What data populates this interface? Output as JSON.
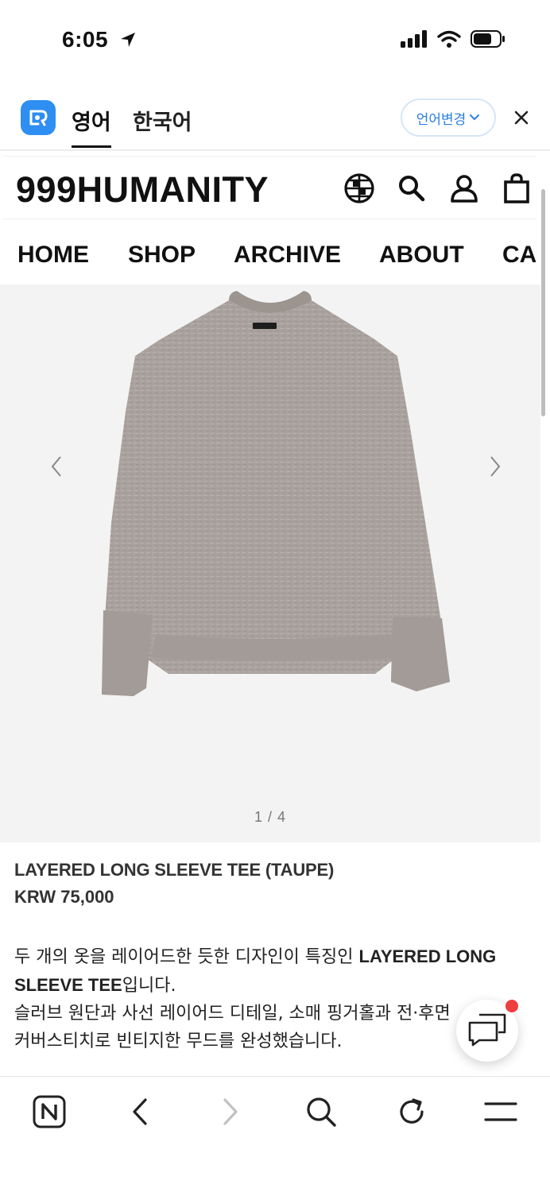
{
  "status_bar": {
    "time": "6:05"
  },
  "translate_bar": {
    "active_lang": "영어",
    "inactive_lang": "한국어",
    "change_label": "언어변경"
  },
  "site": {
    "logo": "999HUMANITY",
    "nav": [
      "HOME",
      "SHOP",
      "ARCHIVE",
      "ABOUT",
      "CA"
    ]
  },
  "gallery": {
    "counter": "1 / 4"
  },
  "product": {
    "title": "LAYERED LONG SLEEVE TEE (TAUPE)",
    "price": "KRW 75,000",
    "desc_line1_prefix": "두 개의 옷을 레이어드한 듯한 디자인이 특징인 ",
    "desc_line1_bold": "LAYERED LONG SLEEVE TEE",
    "desc_line1_suffix": "입니다.",
    "desc_line2": "슬러브 원단과 사선 레이어드 디테일, 소매 핑거홀과 전·후면",
    "desc_line3": "커버스티치로 빈티지한 무드를 완성했습니다."
  },
  "colors": {
    "accent_blue": "#2f8ef2",
    "notification_red": "#ef3e3e",
    "shirt_taupe": "#a9a19d",
    "gallery_bg": "#f3f3f3"
  },
  "icons": {
    "header": [
      "globe-icon",
      "search-icon",
      "account-icon",
      "cart-icon"
    ],
    "toolbar": [
      "naver-home-icon",
      "back-icon",
      "forward-icon",
      "search-icon",
      "reload-icon",
      "menu-icon"
    ]
  }
}
